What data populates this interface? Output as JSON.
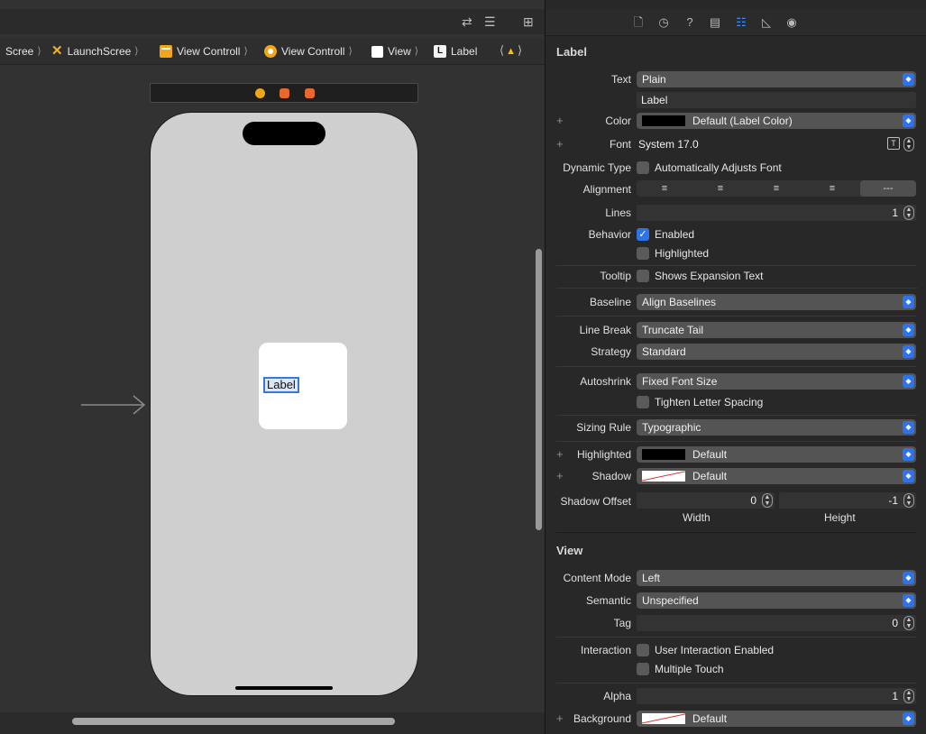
{
  "toolbar": {
    "icons": [
      "arrows-exchange-icon",
      "align-lines-icon",
      "add-panel-icon"
    ]
  },
  "jumpbar": {
    "crumbs": [
      {
        "label": "Scree",
        "icon": "storyboard-icon"
      },
      {
        "label": "LaunchScree",
        "icon": "launchscreen-icon"
      },
      {
        "label": "View Controll",
        "icon": "view-controller-scene-icon"
      },
      {
        "label": "View Controll",
        "icon": "view-controller-icon"
      },
      {
        "label": "View",
        "icon": "view-icon"
      },
      {
        "label": "Label",
        "icon": "label-icon"
      }
    ],
    "warning_icon": "warning-icon"
  },
  "canvas": {
    "label_text": "Label"
  },
  "inspector": {
    "section_label": "Label",
    "text_label": "Text",
    "text_value": "Plain",
    "text_content": "Label",
    "color_label": "Color",
    "color_value": "Default (Label Color)",
    "font_label": "Font",
    "font_value": "System 17.0",
    "dynamic_type_label": "Dynamic Type",
    "dynamic_type_check": "Automatically Adjusts Font",
    "alignment_label": "Alignment",
    "alignment_options": [
      "left",
      "center",
      "right",
      "justified",
      "natural"
    ],
    "alignment_natural_text": "---",
    "lines_label": "Lines",
    "lines_value": "1",
    "behavior_label": "Behavior",
    "behavior_enabled": "Enabled",
    "behavior_highlighted": "Highlighted",
    "tooltip_label": "Tooltip",
    "tooltip_check": "Shows Expansion Text",
    "baseline_label": "Baseline",
    "baseline_value": "Align Baselines",
    "line_break_label": "Line Break",
    "line_break_value": "Truncate Tail",
    "strategy_label": "Strategy",
    "strategy_value": "Standard",
    "autoshrink_label": "Autoshrink",
    "autoshrink_value": "Fixed Font Size",
    "tighten_check": "Tighten Letter Spacing",
    "sizing_rule_label": "Sizing Rule",
    "sizing_rule_value": "Typographic",
    "highlighted_label": "Highlighted",
    "highlighted_value": "Default",
    "shadow_label": "Shadow",
    "shadow_value": "Default",
    "shadow_offset_label": "Shadow Offset",
    "shadow_offset_width": "0",
    "shadow_offset_height": "-1",
    "width_caption": "Width",
    "height_caption": "Height",
    "view_section_label": "View",
    "content_mode_label": "Content Mode",
    "content_mode_value": "Left",
    "semantic_label": "Semantic",
    "semantic_value": "Unspecified",
    "tag_label": "Tag",
    "tag_value": "0",
    "interaction_label": "Interaction",
    "user_interaction_check": "User Interaction Enabled",
    "multiple_touch_check": "Multiple Touch",
    "alpha_label": "Alpha",
    "alpha_value": "1",
    "background_label": "Background",
    "background_value": "Default"
  },
  "colors": {
    "accent": "#2f73e8",
    "canvas_bg": "#323232",
    "inspector_bg": "#282828",
    "popup_bg": "#545454",
    "scene_icon": "#f2a516"
  }
}
